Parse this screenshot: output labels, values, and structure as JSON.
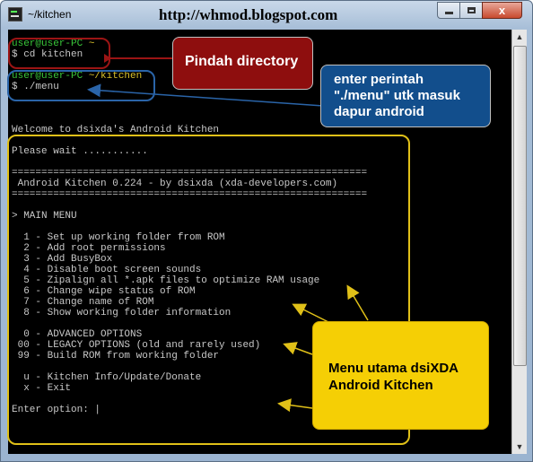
{
  "window": {
    "title": "~/kitchen",
    "overlay_url": "http://whmod.blogspot.com",
    "controls": {
      "close": "x"
    }
  },
  "terminal": {
    "prompt1_user": "user@user-PC",
    "prompt1_dir": "~",
    "cmd1": "$ cd kitchen",
    "prompt2_user": "user@user-PC",
    "prompt2_dir": "~/kitchen",
    "cmd2": "$ ./menu",
    "welcome": "Welcome to dsixda's Android Kitchen",
    "wait": "Please wait ...........",
    "separator": "============================================================",
    "banner": " Android Kitchen 0.224 - by dsixda (xda-developers.com)",
    "main_menu": "> MAIN MENU",
    "menu_items": [
      "  1 - Set up working folder from ROM",
      "  2 - Add root permissions",
      "  3 - Add BusyBox",
      "  4 - Disable boot screen sounds",
      "  5 - Zipalign all *.apk files to optimize RAM usage",
      "  6 - Change wipe status of ROM",
      "  7 - Change name of ROM",
      "  8 - Show working folder information"
    ],
    "advanced_items": [
      "  0 - ADVANCED OPTIONS",
      " 00 - LEGACY OPTIONS (old and rarely used)",
      " 99 - Build ROM from working folder"
    ],
    "extra_items": [
      "  u - Kitchen Info/Update/Donate",
      "  x - Exit"
    ],
    "enter_option": "Enter option: |"
  },
  "annotations": {
    "red": "Pindah directory",
    "blue": [
      "enter perintah",
      "\"./menu\" utk masuk",
      "dapur android"
    ],
    "yellow": [
      "Menu utama dsiXDA",
      "Android Kitchen"
    ]
  },
  "colors": {
    "terminal_bg": "#000000",
    "terminal_text": "#c8c8c8",
    "prompt_green": "#39c539",
    "prompt_dir_yellow": "#d8c02a",
    "annotation_red": "#8e0e0e",
    "annotation_blue": "#124e8c",
    "annotation_yellow": "#f5cf05"
  },
  "icons": {
    "app": "terminal-icon",
    "minimize": "minimize-icon",
    "maximize": "maximize-icon",
    "close": "close-icon",
    "scroll_up": "arrow-up-icon",
    "scroll_down": "arrow-down-icon"
  }
}
